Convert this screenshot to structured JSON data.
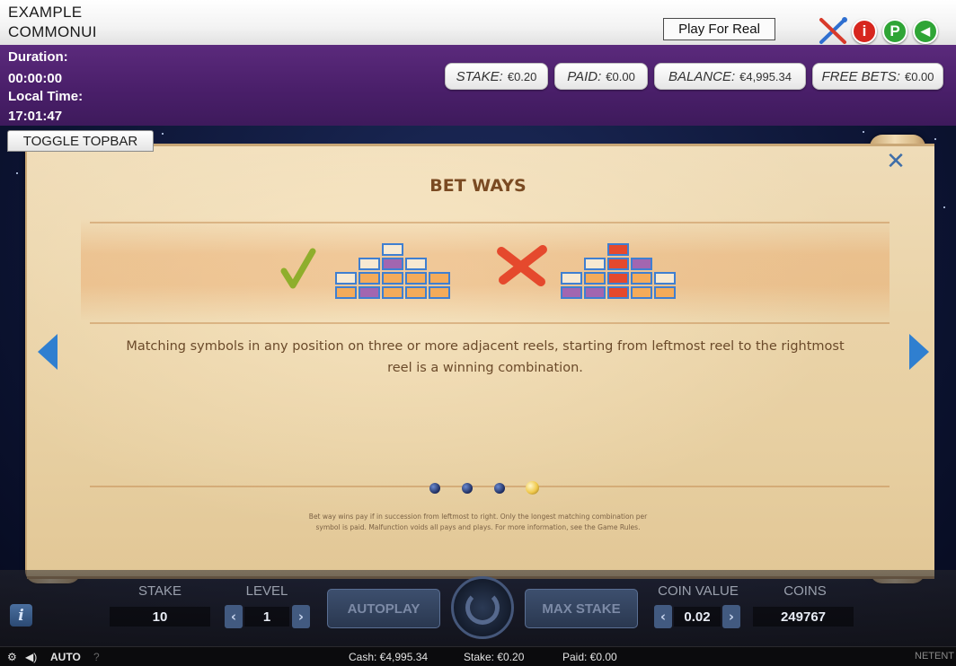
{
  "window": {
    "title_line1": "EXAMPLE",
    "title_line2": "COMMONUI"
  },
  "top_bar": {
    "play_for_real": "Play For Real",
    "icons": [
      "tools-icon",
      "info-icon",
      "paytable-icon",
      "sound-icon"
    ],
    "info_glyph": "i",
    "paytable_glyph": "P",
    "sound_glyph": "◀"
  },
  "session": {
    "duration_label": "Duration:",
    "duration_value": "00:00:00",
    "local_time_label": "Local Time:",
    "local_time_value": "17:01:47"
  },
  "pills": {
    "stake_label": "STAKE:",
    "stake_value": "€0.20",
    "paid_label": "PAID:",
    "paid_value": "€0.00",
    "balance_label": "BALANCE:",
    "balance_value": "€4,995.34",
    "free_bets_label": "FREE BETS:",
    "free_bets_value": "€0.00"
  },
  "toggle_topbar": "TOGGLE TOPBAR",
  "help_page": {
    "title": "BET WAYS",
    "body_line1": "Matching symbols in any position on three or more adjacent reels, starting from leftmost reel to the rightmost",
    "body_line2": "reel is a winning combination.",
    "disclaimer_line1": "Bet way wins pay if in succession from leftmost to right. Only the longest matching combination per",
    "disclaimer_line2": "symbol is paid. Malfunction voids all pays and plays. For more information, see the Game Rules.",
    "close_glyph": "✕",
    "check_glyph": "✓",
    "cross_glyph": "✗",
    "page_count": 4,
    "active_page": 4
  },
  "controls": {
    "stake_label": "STAKE",
    "stake_value": "10",
    "level_label": "LEVEL",
    "level_value": "1",
    "autoplay_label": "AUTOPLAY",
    "max_stake_label": "MAX STAKE",
    "coin_value_label": "COIN VALUE",
    "coin_value": "0.02",
    "coins_label": "COINS",
    "coins_value": "249767",
    "arrow_left": "‹",
    "arrow_right": "›",
    "info_glyph": "i"
  },
  "status_bar": {
    "auto_label": "AUTO",
    "help_glyph": "?",
    "cash": "Cash: €4,995.34",
    "stake": "Stake: €0.20",
    "paid": "Paid: €0.00",
    "brand": "NETENT"
  },
  "colors": {
    "purple_bar": "#4a1f6a",
    "scroll_title": "#7a4a22",
    "nav_arrow": "#2f7fd0",
    "win_cell": "#a266b0",
    "lose_cell": "#e5492d"
  }
}
